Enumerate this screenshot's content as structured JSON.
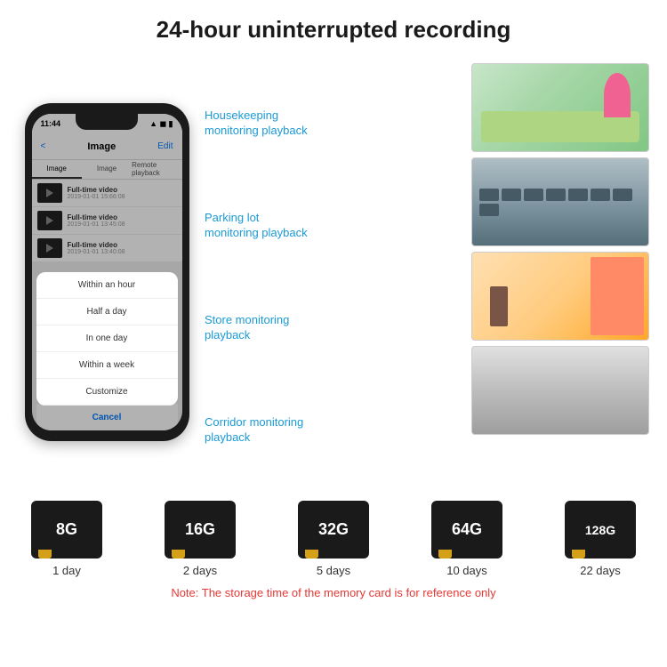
{
  "header": {
    "title": "24-hour uninterrupted recording"
  },
  "phone": {
    "status_time": "11:44",
    "nav_title": "Image",
    "nav_back": "<",
    "nav_edit": "Edit",
    "tabs": [
      "Image",
      "Image",
      "Remote playback"
    ],
    "videos": [
      {
        "title": "Full-time video",
        "date": "2019-01-01 15:66:08"
      },
      {
        "title": "Full-time video",
        "date": "2019-01-01 13:45:08"
      },
      {
        "title": "Full-time video",
        "date": "2019-01-01 13:40:08"
      }
    ],
    "dropdown_items": [
      "Within an hour",
      "Half a day",
      "In one day",
      "Within a week",
      "Customize"
    ],
    "cancel_label": "Cancel"
  },
  "monitoring": {
    "labels": [
      "Housekeeping\nmonitoring playback",
      "Parking lot\nmonitoring playback",
      "Store monitoring\nplayback",
      "Corridor monitoring\nplayback"
    ]
  },
  "storage": {
    "cards": [
      {
        "size": "8G",
        "days": "1 day"
      },
      {
        "size": "16G",
        "days": "2 days"
      },
      {
        "size": "32G",
        "days": "5 days"
      },
      {
        "size": "64G",
        "days": "10 days"
      },
      {
        "size": "128G",
        "days": "22 days"
      }
    ],
    "note": "Note: The storage time of the memory card is for reference only"
  }
}
